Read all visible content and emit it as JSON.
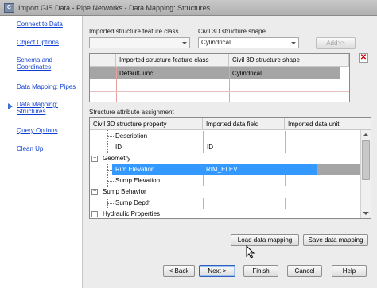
{
  "window": {
    "title": "Import GIS Data - Pipe Networks - Data Mapping: Structures"
  },
  "sidebar": {
    "items": [
      {
        "label": "Connect to Data"
      },
      {
        "label": "Object Options"
      },
      {
        "label": "Schema and Coordinates"
      },
      {
        "label": "Data Mapping: Pipes"
      },
      {
        "label": "Data Mapping: Structures"
      },
      {
        "label": "Query Options"
      },
      {
        "label": "Clean Up"
      }
    ]
  },
  "mapping": {
    "feature_class_label": "Imported structure feature class",
    "feature_class_value": "",
    "shape_label": "Civil 3D structure shape",
    "shape_value": "Cylindrical",
    "add_button": "Add>>"
  },
  "shape_grid": {
    "headers": [
      "Imported structure feature class",
      "Civil 3D structure shape"
    ],
    "rows": [
      {
        "feature_class": "DefaultJunc",
        "shape": "Cylindrical"
      }
    ]
  },
  "attribute_section_label": "Structure attribute assignment",
  "attribute_grid": {
    "headers": [
      "Civil 3D structure property",
      "Imported data field",
      "Imported data unit"
    ],
    "rows": [
      {
        "property": "Description",
        "field": "",
        "unit": ""
      },
      {
        "property": "ID",
        "field": "ID",
        "unit": ""
      },
      {
        "property": "Geometry",
        "field": "",
        "unit": ""
      },
      {
        "property": "Rim Elevation",
        "field": "RIM_ELEV",
        "unit": ""
      },
      {
        "property": "Sump Elevation",
        "field": "",
        "unit": ""
      },
      {
        "property": "Sump Behavior",
        "field": "",
        "unit": ""
      },
      {
        "property": "Sump Depth",
        "field": "",
        "unit": ""
      },
      {
        "property": "Hydraulic Properties",
        "field": "",
        "unit": ""
      }
    ]
  },
  "buttons": {
    "load_mapping": "Load data mapping",
    "save_mapping": "Save data mapping",
    "back": "< Back",
    "next": "Next >",
    "finish": "Finish",
    "cancel": "Cancel",
    "help": "Help"
  }
}
